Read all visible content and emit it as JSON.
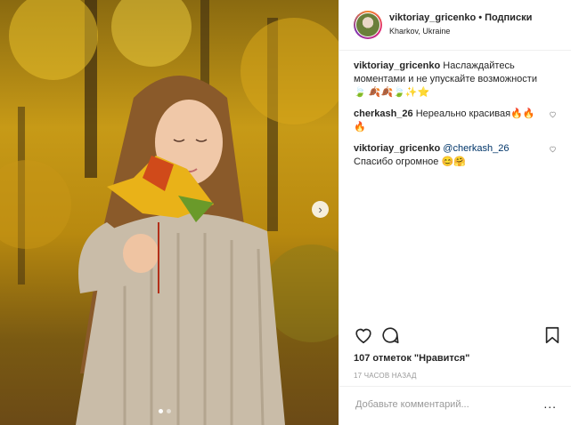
{
  "header": {
    "username": "viktoriay_gricenko",
    "separator": "•",
    "follow_label": "Подписки",
    "location": "Kharkov, Ukraine"
  },
  "comments": [
    {
      "user": "viktoriay_gricenko",
      "text": "Наслаждайтесь моментами и не упускайте возможности",
      "emoji": "🍃 🍂🍂🍃✨⭐",
      "has_like": false
    },
    {
      "user": "cherkash_26",
      "text": "Нереально красивая",
      "emoji": "🔥🔥🔥",
      "has_like": true
    },
    {
      "user": "viktoriay_gricenko",
      "mention": "@cherkash_26",
      "text": "Спасибо огромное",
      "emoji": "😊🤗",
      "has_like": true
    }
  ],
  "likes_text": "107 отметок \"Нравится\"",
  "time_ago": "17 ЧАСОВ НАЗАД",
  "add_comment_placeholder": "Добавьте комментарий...",
  "more_label": "...",
  "carousel": {
    "slides": 2,
    "active": 0
  },
  "icons": {
    "next": "chevron-right-icon",
    "like": "heart-icon",
    "comment": "comment-bubble-icon",
    "save": "bookmark-icon"
  },
  "colors": {
    "text": "#262626",
    "muted": "#999999",
    "mention": "#003569",
    "border": "#efefef"
  }
}
